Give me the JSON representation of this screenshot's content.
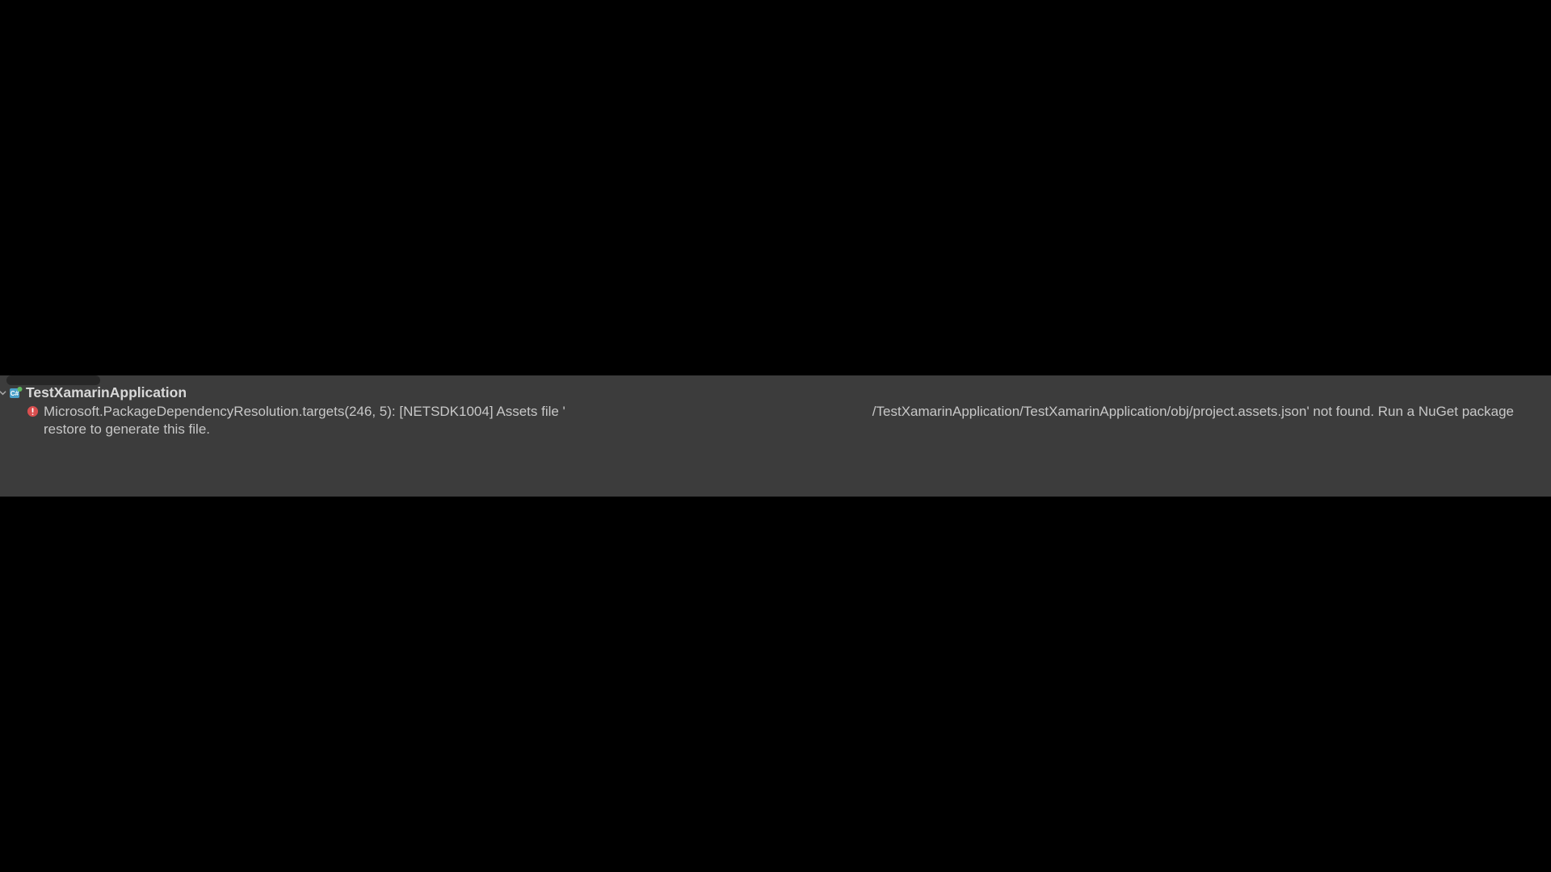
{
  "panel": {
    "project_name": "TestXamarinApplication",
    "error": {
      "prefix": "Microsoft.PackageDependencyResolution.targets(246, 5): [NETSDK1004] Assets file '",
      "path_tail": "/TestXamarinApplication/TestXamarinApplication/obj/project.assets.json' not found. Run a NuGet package",
      "line2": "restore to generate this file."
    }
  }
}
